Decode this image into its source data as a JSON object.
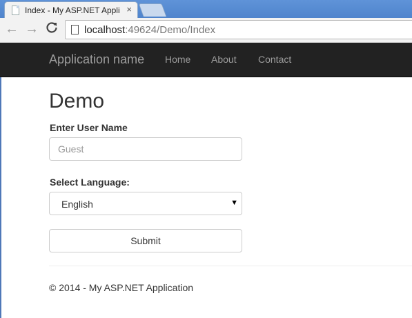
{
  "browser": {
    "tab_title": "Index - My ASP.NET Appli",
    "tab_close": "×",
    "back_glyph": "←",
    "forward_glyph": "→",
    "reload_glyph": "C",
    "url_host": "localhost",
    "url_rest": ":49624/Demo/Index"
  },
  "navbar": {
    "brand": "Application name",
    "links": [
      "Home",
      "About",
      "Contact"
    ],
    "background": "#222222",
    "link_color": "#9d9d9d"
  },
  "main": {
    "title": "Demo",
    "username_label": "Enter User Name",
    "username_placeholder": "Guest",
    "language_label": "Select Language:",
    "language_selected": "English",
    "submit_label": "Submit"
  },
  "footer": {
    "text": "© 2014 - My ASP.NET Application"
  }
}
